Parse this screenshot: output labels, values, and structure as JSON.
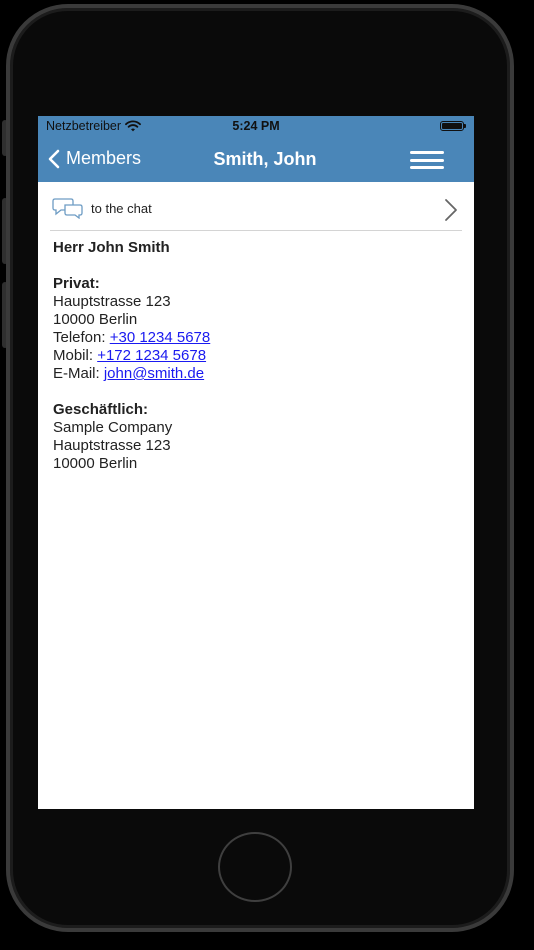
{
  "status_bar": {
    "carrier": "Netzbetreiber",
    "time": "5:24 PM",
    "battery_level": 1.0
  },
  "nav": {
    "back_label": "Members",
    "title": "Smith, John",
    "back_icon": "chevron-left-icon",
    "menu_icon": "hamburger-menu-icon"
  },
  "chat_row": {
    "label": "to the chat",
    "icon": "chat-bubbles-icon",
    "chevron_icon": "chevron-right-icon"
  },
  "contact": {
    "name": "Herr John Smith",
    "private": {
      "heading": "Privat:",
      "street": "Hauptstrasse 123",
      "city": "10000 Berlin",
      "phone_label": "Telefon: ",
      "phone": "+30 1234 5678",
      "mobile_label": "Mobil: ",
      "mobile": "+172 1234 5678",
      "email_label": "E-Mail: ",
      "email": "john@smith.de"
    },
    "business": {
      "heading": "Geschäftlich:",
      "company": "Sample Company",
      "street": "Hauptstrasse 123",
      "city": "10000 Berlin"
    }
  },
  "colors": {
    "nav_background": "#4a86b8",
    "link": "#1a1af0",
    "device_background": "#000000"
  }
}
